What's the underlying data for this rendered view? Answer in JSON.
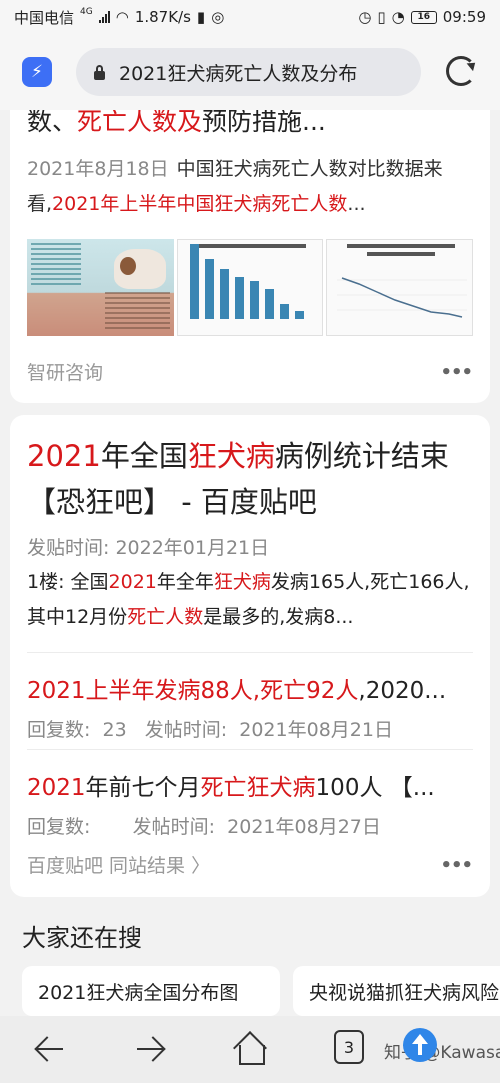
{
  "status_bar": {
    "carrier": "中国电信",
    "network": "4G",
    "speed": "1.87K/s",
    "battery": "16",
    "time": "09:59"
  },
  "address_bar": {
    "url_text": "2021狂犬病死亡人数及分布"
  },
  "card1": {
    "title_pre": "数、",
    "title_red": "死亡人数及",
    "title_post": "预防措施...",
    "date": "2021年8月18日",
    "snippet_a": "中国狂犬病死亡人数对比数据来看,",
    "snippet_red": "2021年上半年中国狂犬病死亡人数",
    "snippet_b": "...",
    "source": "智研咨询",
    "more": "•••",
    "image_bar_values": [
      75,
      60,
      50,
      42,
      38,
      30,
      15,
      8
    ]
  },
  "card2": {
    "title_red1": "2021",
    "title_t1": "年全国",
    "title_red2": "狂犬病",
    "title_t2": "病例统计结束【恐狂吧】 - 百度贴吧",
    "post_time": "发贴时间: 2022年01月21日",
    "snippet_a": "1楼: 全国",
    "snippet_red1": "2021",
    "snippet_b": "年全年",
    "snippet_red2": "狂犬病",
    "snippet_c": "发病165人,死亡166人,其中12月份",
    "snippet_red3": "死亡人数",
    "snippet_d": "是最多的,发病8...",
    "sub1_red": "2021上半年发病88人,死亡92人",
    "sub1_rest": ",2020...",
    "sub1_meta": "回复数:  23   发帖时间:  2021年08月21日",
    "sub2_red1": "2021",
    "sub2_t1": "年前七个月",
    "sub2_red2": "死亡狂犬病",
    "sub2_t2": "100人 【...",
    "sub2_meta": "回复数:       发帖时间:  2021年08月27日",
    "source": "百度贴吧  同站结果 〉",
    "more": "•••"
  },
  "related": {
    "title": "大家还在搜",
    "chips": [
      "2021狂犬病全国分布图",
      "央视说猫抓狂犬病风险"
    ]
  },
  "navbar": {
    "tabs_count": "3",
    "watermark": "知乎 @Kawasaki"
  }
}
